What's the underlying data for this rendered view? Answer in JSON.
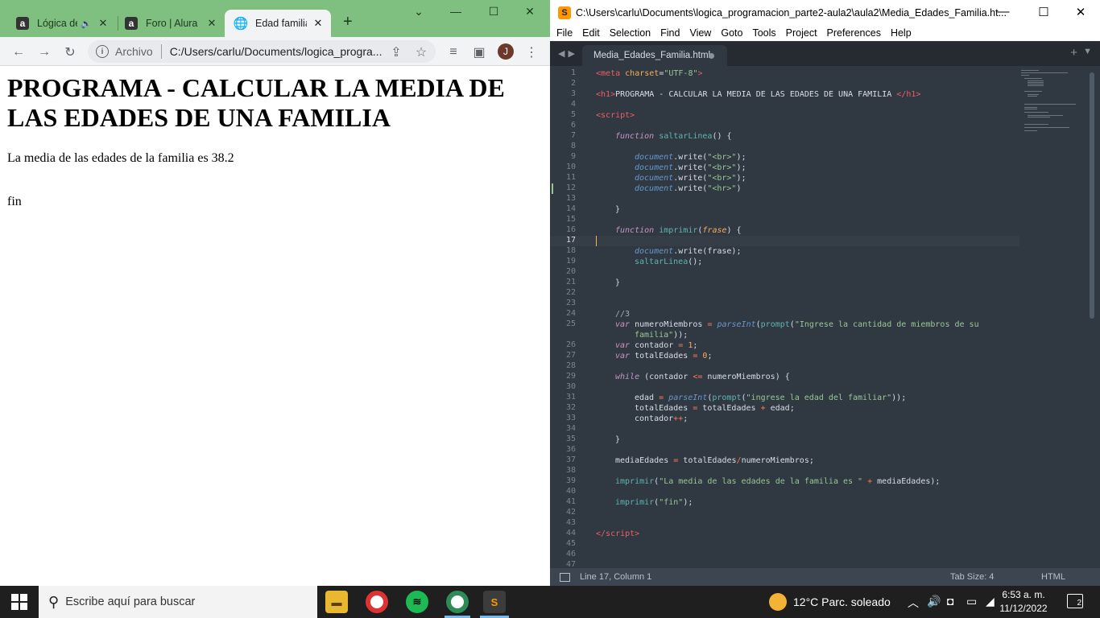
{
  "chrome": {
    "tabs": [
      {
        "title": "Lógica de",
        "icon": "a",
        "sound": "speaker-icon"
      },
      {
        "title": "Foro | Alura L",
        "icon": "a"
      },
      {
        "title": "Edad familiar",
        "icon": "globe-icon"
      }
    ],
    "omnibox": {
      "chip": "Archivo",
      "url": "C:/Users/carlu/Documents/logica_progra..."
    },
    "avatar": "J",
    "page": {
      "heading": "PROGRAMA - CALCULAR LA MEDIA DE LAS EDADES DE UNA FAMILIA",
      "result": "La media de las edades de la familia es 38.2",
      "end": "fin"
    }
  },
  "sublime": {
    "title": "C:\\Users\\carlu\\Documents\\logica_programacion_parte2-aula2\\aula2\\Media_Edades_Familia.ht...",
    "menu": [
      "File",
      "Edit",
      "Selection",
      "Find",
      "View",
      "Goto",
      "Tools",
      "Project",
      "Preferences",
      "Help"
    ],
    "tab": "Media_Edades_Familia.html",
    "status": {
      "position": "Line 17, Column 1",
      "tab_size": "Tab Size: 4",
      "syntax": "HTML"
    },
    "code": {
      "l1a": "<",
      "l1b": "meta",
      "l1c": "charset",
      "l1d": "=",
      "l1e": "\"UTF-8\"",
      "l1f": ">",
      "l3a": "<",
      "l3b": "h1",
      "l3c": ">",
      "l3d": "PROGRAMA - CALCULAR LA MEDIA DE LAS EDADES DE UNA FAMILIA ",
      "l3e": "</",
      "l3f": "h1",
      "l3g": ">",
      "l5a": "<",
      "l5b": "script",
      "l5c": ">",
      "l7a": "function",
      "l7b": "saltarLinea",
      "l7c": "() {",
      "wr_obj": "document",
      "wr_fn": ".write(",
      "br": "\"<br>\"",
      "hr": "\"<hr>\"",
      "semi_close": ");",
      "close": ")",
      "brace": "}",
      "l16a": "function",
      "l16b": "imprimir",
      "l16c": "(",
      "l16d": "frase",
      "l16e": ") {",
      "l18a": "document",
      "l18b": ".write(frase);",
      "l19a": "saltarLinea",
      "l19b": "();",
      "l24": "//3",
      "var": "var",
      "l25a": " numeroMiembros ",
      "eq": "=",
      "parseInt": "parseInt",
      "prompt": "prompt",
      "l25b": "\"Ingrese la cantidad de miembros de su",
      "l25c": "familia\"",
      "l25d": "));",
      "l26a": " contador ",
      "one": "1",
      "semicolon": ";",
      "l27a": " totalEdades ",
      "zero": "0",
      "l29a": "while",
      "l29b": " (contador ",
      "le": "<=",
      "l29c": " numeroMiembros) {",
      "l31a": "edad ",
      "l31b": "\"ingrese la edad del familiar\"",
      "l31c": "));",
      "l32a": "totalEdades ",
      "l32b": " totalEdades ",
      "plus": "+",
      "l32c": " edad;",
      "l33a": "contador",
      "pp": "++",
      "l37a": "mediaEdades ",
      "l37b": " totalEdades",
      "slash": "/",
      "l37c": "numeroMiembros;",
      "l39a": "imprimir",
      "l39b": "(",
      "l39c": "\"La media de las edades de la familia es \"",
      "l39d": " mediaEdades);",
      "l41a": "imprimir",
      "l41b": "(",
      "l41c": "\"fin\"",
      "l41d": ");",
      "l44a": "</",
      "l44b": "script",
      "l44c": ">"
    },
    "line_numbers": [
      "1",
      "2",
      "3",
      "4",
      "5",
      "6",
      "7",
      "8",
      "9",
      "10",
      "11",
      "12",
      "13",
      "14",
      "15",
      "16",
      "17",
      "18",
      "19",
      "20",
      "21",
      "22",
      "23",
      "24",
      "25",
      "",
      "26",
      "27",
      "28",
      "29",
      "30",
      "31",
      "32",
      "33",
      "34",
      "35",
      "36",
      "37",
      "38",
      "39",
      "40",
      "41",
      "42",
      "43",
      "44",
      "45",
      "46",
      "47"
    ]
  },
  "taskbar": {
    "search_placeholder": "Escribe aquí para buscar",
    "weather": "12°C  Parc. soleado",
    "time": "6:53 a. m.",
    "date": "11/12/2022",
    "notifications": "2"
  }
}
